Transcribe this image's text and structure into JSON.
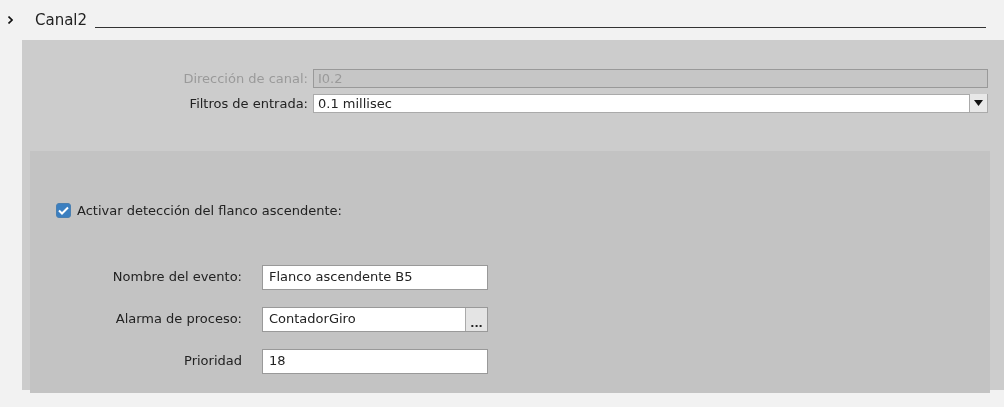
{
  "section": {
    "title": "Canal2"
  },
  "channel_fields": [
    {
      "kind": "text",
      "label": "Dirección de canal:",
      "value": "I0.2",
      "disabled": true
    },
    {
      "kind": "dropdown",
      "label": "Filtros de entrada:",
      "value": "0.1 millisec",
      "disabled": false
    }
  ],
  "rising_edge": {
    "label": "Activar detección del flanco ascendente:",
    "checked": true
  },
  "event_fields": [
    {
      "kind": "text",
      "label": "Nombre del evento:",
      "value": "Flanco ascendente B5"
    },
    {
      "kind": "browse",
      "label": "Alarma de proceso:",
      "value": "ContadorGiro",
      "button": "..."
    },
    {
      "kind": "text",
      "label": "Prioridad",
      "value": "18"
    }
  ]
}
